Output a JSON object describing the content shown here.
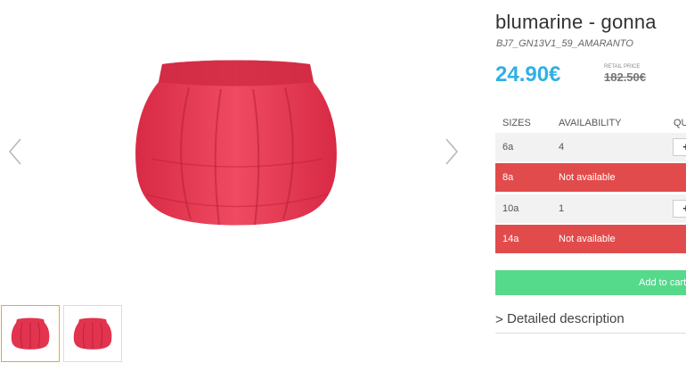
{
  "product": {
    "title": "blumarine - gonna",
    "sku": "BJ7_GN13V1_59_AMARANTO",
    "price": "24.90€",
    "retail_label": "RETAIL PRICE",
    "retail_price": "182.50€"
  },
  "sizes_table": {
    "headers": {
      "size": "SIZES",
      "availability": "AVAILABILITY",
      "quantity": "QU"
    },
    "rows": [
      {
        "size": "6a",
        "availability": "4",
        "stepper": "+"
      },
      {
        "size": "8a",
        "availability": "Not available"
      },
      {
        "size": "10a",
        "availability": "1",
        "stepper": "+"
      },
      {
        "size": "14a",
        "availability": "Not available"
      }
    ]
  },
  "actions": {
    "add_to_cart": "Add to cart",
    "detailed_description": "Detailed description",
    "chevron": ">"
  },
  "colors": {
    "price": "#31b0e6",
    "unavailable": "#e24b4b",
    "add_to_cart": "#55d98a",
    "skirt": "#e2334f",
    "active_thumb_border": "#e8a63a"
  },
  "icons": {
    "prev": "chevron-left-icon",
    "next": "chevron-right-icon"
  }
}
